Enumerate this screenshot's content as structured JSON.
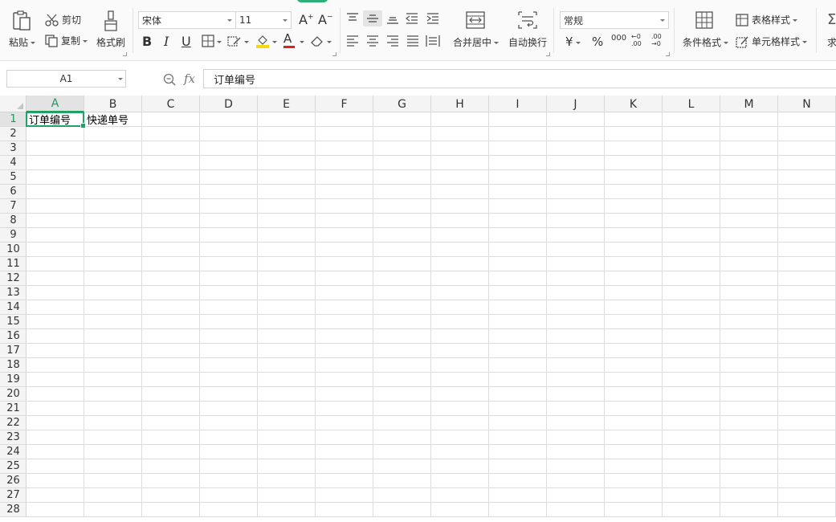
{
  "ribbon": {
    "paste_label": "粘贴",
    "cut_label": "剪切",
    "copy_label": "复制",
    "format_painter_label": "格式刷",
    "font_name": "宋体",
    "font_size": "11",
    "bold_glyph": "B",
    "italic_glyph": "I",
    "underline_glyph": "U",
    "font_color_glyph": "A",
    "merge_center_label": "合并居中",
    "wrap_text_label": "自动换行",
    "number_format": "常规",
    "currency_glyph": "¥",
    "percent_glyph": "%",
    "thousands_glyph": "000",
    "inc_decimal_glyph": "←0 .00",
    "dec_decimal_glyph": ".00 →0",
    "conditional_format_label": "条件格式",
    "table_style_label": "表格样式",
    "cell_style_label": "单元格样式",
    "sum_label": "求",
    "colors": {
      "accent": "#1a9a5c",
      "font_color_bar": "#e02020",
      "fill_color_bar": "#f5d90a"
    }
  },
  "formula_bar": {
    "name_box": "A1",
    "fx": "fx",
    "content": "订单编号"
  },
  "grid": {
    "columns": [
      "A",
      "B",
      "C",
      "D",
      "E",
      "F",
      "G",
      "H",
      "I",
      "J",
      "K",
      "L",
      "M",
      "N"
    ],
    "rows": [
      "1",
      "2",
      "3",
      "4",
      "5",
      "6",
      "7",
      "8",
      "9",
      "10",
      "11",
      "12",
      "13",
      "14",
      "15",
      "16",
      "17",
      "18",
      "19",
      "20",
      "21",
      "22",
      "23",
      "24",
      "25",
      "26",
      "27",
      "28"
    ],
    "selected": {
      "col": "A",
      "row": "1"
    },
    "cells": {
      "A1": "订单编号",
      "B1": "快递单号"
    }
  }
}
